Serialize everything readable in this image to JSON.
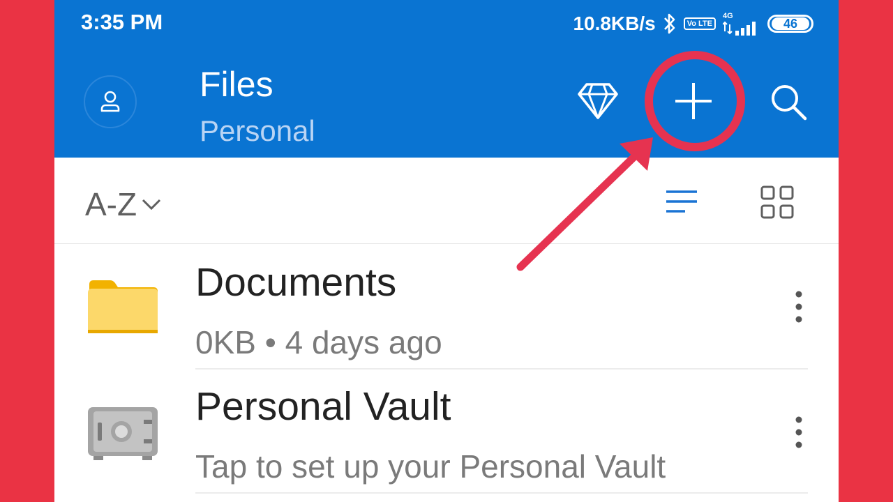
{
  "status_bar": {
    "time": "3:35 PM",
    "net_speed": "10.8KB/s",
    "volte": "Vo LTE",
    "signal_type": "4G",
    "battery": "46",
    "icons": [
      "bluetooth-icon",
      "volte-icon",
      "signal-icon",
      "battery-icon"
    ]
  },
  "header": {
    "title": "Files",
    "subtitle": "Personal",
    "actions": [
      "premium-diamond-icon",
      "add-icon",
      "search-icon"
    ]
  },
  "toolbar": {
    "sort_label": "A-Z",
    "view_options": [
      "list-view-icon",
      "grid-view-icon"
    ]
  },
  "items": [
    {
      "name": "Documents",
      "meta": "0KB • 4 days ago",
      "icon": "folder-icon"
    },
    {
      "name": "Personal Vault",
      "meta": "Tap to set up your Personal Vault",
      "icon": "vault-icon"
    }
  ],
  "colors": {
    "appbar": "#0a74d2",
    "frame": "#ea3344",
    "annotation": "#e63350",
    "accent": "#1a73d4"
  }
}
